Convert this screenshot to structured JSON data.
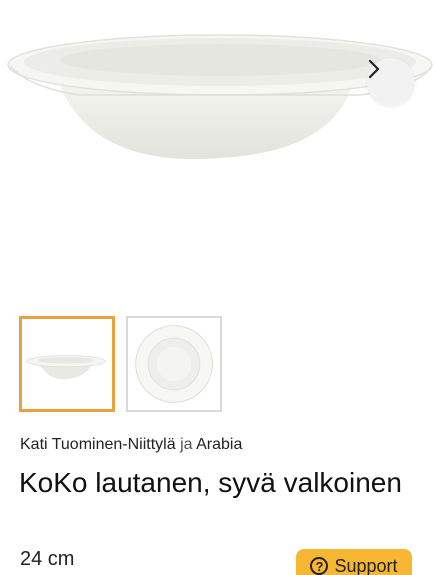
{
  "gallery": {
    "next_icon": "chevron-right-icon",
    "thumbnails": [
      {
        "alt": "side view",
        "active": true
      },
      {
        "alt": "top view",
        "active": false
      }
    ]
  },
  "product": {
    "designer": "Kati Tuominen-Niittylä",
    "conjunction": "ja",
    "brand": "Arabia",
    "name": "KoKo lautanen, syvä valkoinen",
    "size": "24 cm"
  },
  "support": {
    "label": "Support",
    "icon": "question-icon",
    "icon_glyph": "?"
  },
  "colors": {
    "active_thumb_border": "#e9a23b",
    "support_bg": "#f7b733"
  }
}
